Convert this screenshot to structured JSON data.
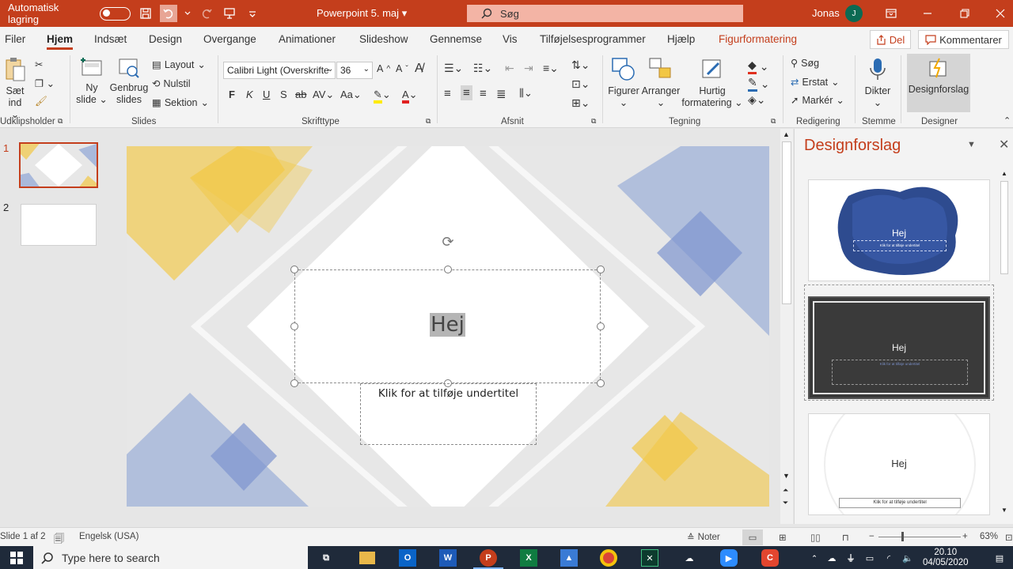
{
  "titlebar": {
    "autosave_label": "Automatisk lagring",
    "filename": "Powerpoint 5. maj",
    "search_placeholder": "Søg",
    "user_name": "Jonas",
    "user_initial": "J"
  },
  "tabs": [
    {
      "label": "Filer"
    },
    {
      "label": "Hjem"
    },
    {
      "label": "Indsæt"
    },
    {
      "label": "Design"
    },
    {
      "label": "Overgange"
    },
    {
      "label": "Animationer"
    },
    {
      "label": "Slideshow"
    },
    {
      "label": "Gennemse"
    },
    {
      "label": "Vis"
    },
    {
      "label": "Tilføjelsesprogrammer"
    },
    {
      "label": "Hjælp"
    },
    {
      "label": "Figurformatering"
    }
  ],
  "share_label": "Del",
  "comment_label": "Kommentarer",
  "ribbon": {
    "clipboard": {
      "paste_line1": "Sæt",
      "paste_line2": "ind",
      "group": "Udklipsholder"
    },
    "slides": {
      "new_line1": "Ny",
      "new_line2": "slide",
      "reuse_line1": "Genbrug",
      "reuse_line2": "slides",
      "layout": "Layout",
      "reset": "Nulstil",
      "section": "Sektion",
      "group": "Slides"
    },
    "font": {
      "family": "Calibri Light (Overskrifte",
      "size": "36",
      "bold": "F",
      "italic": "K",
      "underline": "U",
      "shadow": "S",
      "strike": "ab",
      "spacing": "AV",
      "case": "Aa",
      "group": "Skrifttype"
    },
    "paragraph": {
      "group": "Afsnit"
    },
    "drawing": {
      "shapes": "Figurer",
      "arrange": "Arranger",
      "quick_line1": "Hurtig",
      "quick_line2": "formatering",
      "group": "Tegning"
    },
    "editing": {
      "find": "Søg",
      "replace": "Erstat",
      "select": "Markér",
      "group": "Redigering"
    },
    "voice": {
      "dictate": "Dikter",
      "group": "Stemme"
    },
    "designer": {
      "button": "Designforslag",
      "group": "Designer"
    }
  },
  "thumbnails": [
    {
      "number": "1"
    },
    {
      "number": "2"
    }
  ],
  "slide": {
    "title": "Hej",
    "subtitle_placeholder": "Klik for at tilføje undertitel"
  },
  "design_pane": {
    "title": "Designforslag",
    "cards": [
      {
        "title": "Hej",
        "subtitle": "Klik for at tilføje undertitel"
      },
      {
        "title": "Hej",
        "subtitle": "Klik for at tilføje undertitel"
      },
      {
        "title": "Hej",
        "subtitle": "Klik for at tilføje undertitel"
      }
    ]
  },
  "status": {
    "slide_info": "Slide 1 af 2",
    "language": "Engelsk (USA)",
    "notes": "Noter",
    "zoom": "63%"
  },
  "taskbar": {
    "search_placeholder": "Type here to search",
    "time": "20.10",
    "date": "04/05/2020"
  },
  "colors": {
    "accent": "#c43e1c",
    "slide_yellow": "#f2c744",
    "slide_blue": "#8ea5d6"
  }
}
